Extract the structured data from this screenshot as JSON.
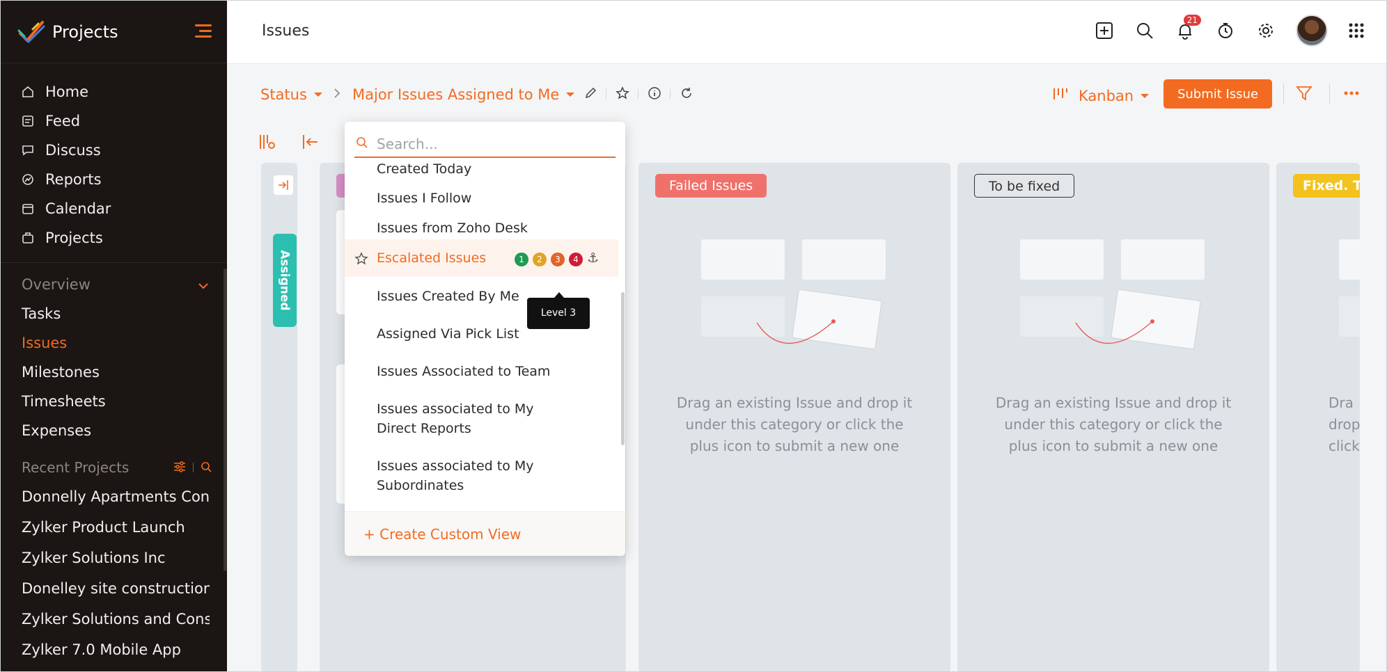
{
  "app": {
    "title": "Projects"
  },
  "header": {
    "page_title": "Issues",
    "notifications_count": "21"
  },
  "sidebar": {
    "main_items": [
      {
        "label": "Home",
        "icon": "home-icon"
      },
      {
        "label": "Feed",
        "icon": "feed-icon"
      },
      {
        "label": "Discuss",
        "icon": "discuss-icon"
      },
      {
        "label": "Reports",
        "icon": "reports-icon"
      },
      {
        "label": "Calendar",
        "icon": "calendar-icon"
      },
      {
        "label": "Projects",
        "icon": "projects-icon"
      }
    ],
    "overview_label": "Overview",
    "overview_items": [
      "Tasks",
      "Issues",
      "Milestones",
      "Timesheets",
      "Expenses"
    ],
    "active_item": "Issues",
    "recent_label": "Recent Projects",
    "recent_projects": [
      "Donnelly Apartments Cons",
      "Zylker Product Launch",
      "Zylker Solutions Inc",
      "Donelley site construction",
      "Zylker Solutions and Const",
      "Zylker 7.0 Mobile App"
    ]
  },
  "subheader": {
    "status_label": "Status",
    "view_label": "Major Issues Assigned to Me",
    "layout_label": "Kanban",
    "submit_label": "Submit Issue"
  },
  "board": {
    "collapsed_column_label": "Assigned",
    "columns": [
      {
        "tag": "Failed Issues",
        "tag_color": "#f0716b",
        "tag_text_color": "#ffffff",
        "empty_text": "Drag an existing Issue and drop it under this category or click the plus icon to submit a new one"
      },
      {
        "tag": "To be fixed",
        "tag_color": "#e4e7ea",
        "tag_text_color": "#333333",
        "empty_text": "Drag an existing Issue and drop it under this category or click the plus icon to submit a new one"
      },
      {
        "tag": "Fixed. T",
        "tag_color": "#f4c21e",
        "tag_text_color": "#ffffff",
        "empty_text": "Dra drop click"
      }
    ]
  },
  "dropdown": {
    "search_placeholder": "Search...",
    "items": [
      "Created Today",
      "Issues I Follow",
      "Issues from Zoho Desk",
      "Escalated Issues",
      "Issues Created By Me",
      "Assigned Via Pick List",
      "Issues Associated to Team",
      "Issues associated to My Direct Reports",
      "Issues associated to My Subordinates"
    ],
    "highlighted_item": "Escalated Issues",
    "levels": [
      {
        "label": "1",
        "color": "#1f9a55"
      },
      {
        "label": "2",
        "color": "#e0a526"
      },
      {
        "label": "3",
        "color": "#e0652b"
      },
      {
        "label": "4",
        "color": "#d01b36"
      }
    ],
    "tooltip": "Level 3",
    "create_label": "+ Create Custom View"
  },
  "colors": {
    "accent": "#f26b21",
    "sidebar_bg": "#1b1613",
    "teal": "#2bbfb0"
  }
}
